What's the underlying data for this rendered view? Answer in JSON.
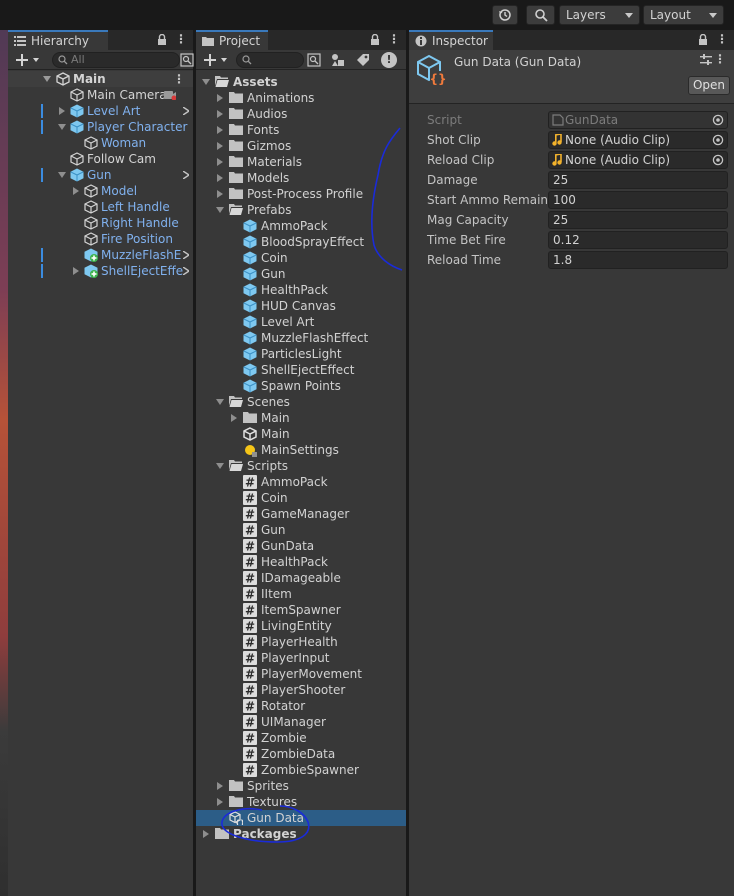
{
  "toolbar": {
    "history_icon": "history-icon",
    "search_icon": "search-icon",
    "layers_label": "Layers",
    "layout_label": "Layout"
  },
  "hierarchy": {
    "tab_label": "Hierarchy",
    "search_placeholder": "All",
    "scene_name": "Main",
    "items": [
      {
        "label": "Main Camera",
        "color": "white",
        "depth": 1
      },
      {
        "label": "Level Art",
        "color": "blue",
        "depth": 1
      },
      {
        "label": "Player Character",
        "color": "blue",
        "depth": 1
      },
      {
        "label": "Woman",
        "color": "blue",
        "depth": 2
      },
      {
        "label": "Follow Cam",
        "color": "white",
        "depth": 1
      },
      {
        "label": "Gun",
        "color": "blue",
        "depth": 1
      },
      {
        "label": "Model",
        "color": "blue",
        "depth": 2
      },
      {
        "label": "Left Handle",
        "color": "blue",
        "depth": 2
      },
      {
        "label": "Right Handle",
        "color": "blue",
        "depth": 2
      },
      {
        "label": "Fire Position",
        "color": "blue",
        "depth": 2
      },
      {
        "label": "MuzzleFlashE",
        "color": "blue",
        "depth": 2
      },
      {
        "label": "ShellEjectEffe",
        "color": "blue",
        "depth": 2
      }
    ]
  },
  "project": {
    "tab_label": "Project",
    "root": "Assets",
    "folders": [
      "Animations",
      "Audios",
      "Fonts",
      "Gizmos",
      "Materials",
      "Models",
      "Post-Process Profile",
      "Prefabs"
    ],
    "prefabs": [
      "AmmoPack",
      "BloodSprayEffect",
      "Coin",
      "Gun",
      "HealthPack",
      "HUD Canvas",
      "Level Art",
      "MuzzleFlashEffect",
      "ParticlesLight",
      "ShellEjectEffect",
      "Spawn Points"
    ],
    "scenes_folder": "Scenes",
    "scenes": [
      "Main",
      "Main",
      "MainSettings"
    ],
    "scripts_folder": "Scripts",
    "scripts": [
      "AmmoPack",
      "Coin",
      "GameManager",
      "Gun",
      "GunData",
      "HealthPack",
      "IDamageable",
      "IItem",
      "ItemSpawner",
      "LivingEntity",
      "PlayerHealth",
      "PlayerInput",
      "PlayerMovement",
      "PlayerShooter",
      "Rotator",
      "UIManager",
      "Zombie",
      "ZombieData",
      "ZombieSpawner"
    ],
    "after_scripts": [
      "Sprites",
      "Textures"
    ],
    "selected": "Gun Data",
    "packages": "Packages"
  },
  "inspector": {
    "tab_label": "Inspector",
    "title": "Gun Data (Gun Data)",
    "open_button": "Open",
    "fields": [
      {
        "label": "Script",
        "value": "GunData"
      },
      {
        "label": "Shot Clip",
        "value": "None (Audio Clip)"
      },
      {
        "label": "Reload Clip",
        "value": "None (Audio Clip)"
      },
      {
        "label": "Damage",
        "value": "25"
      },
      {
        "label": "Start Ammo Remain",
        "value": "100"
      },
      {
        "label": "Mag Capacity",
        "value": "25"
      },
      {
        "label": "Time Bet Fire",
        "value": "0.12"
      },
      {
        "label": "Reload Time",
        "value": "1.8"
      }
    ]
  },
  "colors": {
    "selection": "#2c5d87",
    "prefab_blue": "#80b1ee",
    "annotation": "#1a2bd9"
  }
}
